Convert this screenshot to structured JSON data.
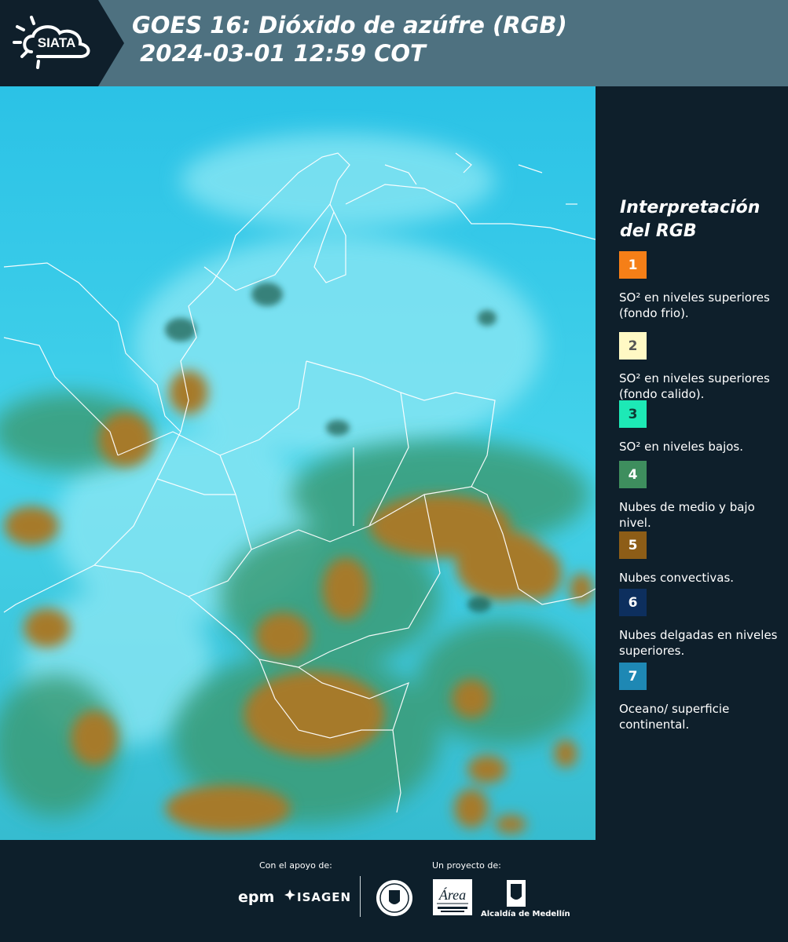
{
  "header": {
    "logo_text": "SIATA",
    "title_line1": "GOES 16: Dióxido de azúfre (RGB)",
    "title_line2": " 2024-03-01 12:59 COT",
    "colors": {
      "bar": "#4e7180",
      "logo_panel": "#0f1f2b"
    }
  },
  "legend": {
    "title": "Interpretación del RGB",
    "items": [
      {
        "number": "1",
        "color": "#f57f17",
        "text_color": "#ffffff",
        "label": "SO² en niveles superiores (fondo frio)."
      },
      {
        "number": "2",
        "color": "#fff9c4",
        "text_color": "#555555",
        "label": "SO² en niveles superiores (fondo calido)."
      },
      {
        "number": "3",
        "color": "#1de9b6",
        "text_color": "#0e3b35",
        "label": "SO² en niveles bajos."
      },
      {
        "number": "4",
        "color": "#3e8e5e",
        "text_color": "#ffffff",
        "label": "Nubes de medio y bajo nivel."
      },
      {
        "number": "5",
        "color": "#8d5d17",
        "text_color": "#ffffff",
        "label": "Nubes convectivas."
      },
      {
        "number": "6",
        "color": "#0d2f5e",
        "text_color": "#ffffff",
        "label": "Nubes delgadas en niveles superiores."
      },
      {
        "number": "7",
        "color": "#1e88b4",
        "text_color": "#ffffff",
        "label": "Oceano/ superficie continental."
      }
    ]
  },
  "footer": {
    "support_label": "Con el apoyo de:",
    "project_label": "Un proyecto de:",
    "sponsor1": "epm",
    "sponsor2": "ISAGEN",
    "partner_area": "Área Metropolitana Valle de Aburrá",
    "partner_alcaldia": "Alcaldía de Medellín",
    "partner_seal": "Medellín"
  }
}
